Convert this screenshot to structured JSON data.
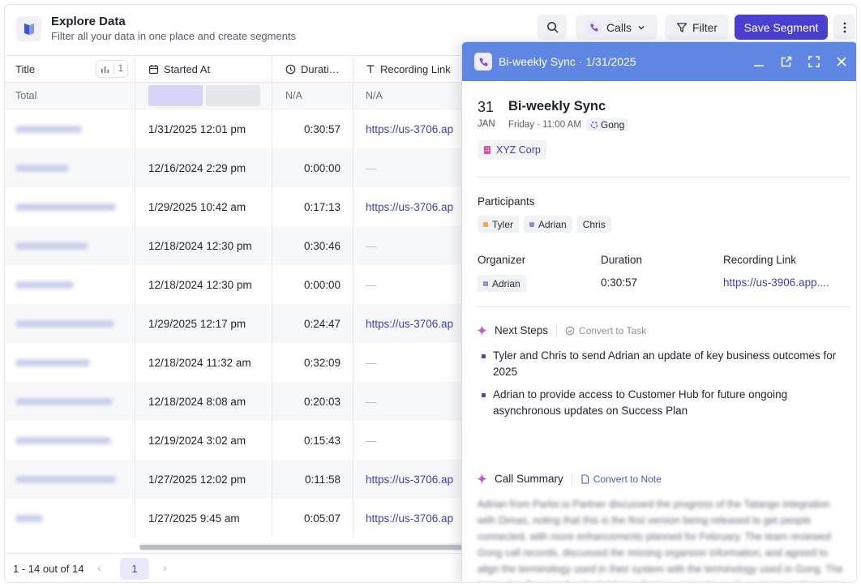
{
  "header": {
    "title": "Explore Data",
    "subtitle": "Filter all your data in one place and create segments",
    "logo_icon": "book-icon",
    "search_icon": "search-icon",
    "calls_label": "Calls",
    "calls_icon": "phone-icon",
    "filter_label": "Filter",
    "save_label": "Save Segment",
    "more_icon": "more-vertical-icon"
  },
  "table": {
    "columns": {
      "title": "Title",
      "title_sort_count": "1",
      "started_at": "Started At",
      "duration": "Durati…",
      "recording_link": "Recording Link"
    },
    "total": {
      "label": "Total",
      "duration": "N/A",
      "link": "N/A"
    },
    "rows": [
      {
        "started_at": "1/31/2025 12:01 pm",
        "duration": "0:30:57",
        "link": "https://us-3706.ap"
      },
      {
        "started_at": "12/16/2024 2:29 pm",
        "duration": "0:00:00",
        "link": "—"
      },
      {
        "started_at": "1/29/2025 10:42 am",
        "duration": "0:17:13",
        "link": "https://us-3706.ap"
      },
      {
        "started_at": "12/18/2024 12:30 pm",
        "duration": "0:30:46",
        "link": "—"
      },
      {
        "started_at": "12/18/2024 12:30 pm",
        "duration": "0:00:00",
        "link": "—"
      },
      {
        "started_at": "1/29/2025 12:17 pm",
        "duration": "0:24:47",
        "link": "https://us-3706.ap"
      },
      {
        "started_at": "12/18/2024 11:32 am",
        "duration": "0:32:09",
        "link": "—"
      },
      {
        "started_at": "12/18/2024 8:08 am",
        "duration": "0:20:03",
        "link": "—"
      },
      {
        "started_at": "12/19/2024 3:02 am",
        "duration": "0:15:43",
        "link": "—"
      },
      {
        "started_at": "1/27/2025 12:02 pm",
        "duration": "0:11:58",
        "link": "https://us-3706.ap"
      },
      {
        "started_at": "1/27/2025 9:45 am",
        "duration": "0:05:07",
        "link": "https://us-3706.ap"
      }
    ]
  },
  "footer": {
    "range": "1 - 14 out of 14",
    "current_page": "1"
  },
  "panel": {
    "title": "Bi-weekly Sync · 1/31/2025",
    "date_day": "31",
    "date_month": "JAN",
    "event_title": "Bi-weekly Sync",
    "event_when": "Friday · 11:00 AM",
    "source": "Gong",
    "company": "XYZ Corp",
    "participants_label": "Participants",
    "participants": [
      {
        "name": "Tyler",
        "color": "#f0a85a"
      },
      {
        "name": "Adrian",
        "color": "#8b8fd8"
      },
      {
        "name": "Chris",
        "color": ""
      }
    ],
    "organizer_label": "Organizer",
    "organizer": "Adrian",
    "duration_label": "Duration",
    "duration": "0:30:57",
    "recording_label": "Recording Link",
    "recording": "https://us-3906.app....",
    "next_steps_label": "Next Steps",
    "convert_task": "Convert to Task",
    "next_steps": [
      "Tyler and Chris to send Adrian an update of key business outcomes for 2025",
      "Adrian to provide access to Customer Hub for future ongoing asynchronous updates on Success Plan"
    ],
    "summary_label": "Call Summary",
    "convert_note": "Convert to Note",
    "summary_text": "Adrian from Parlor.io Partner discussed the progress of the Tatango integration with Dimas, noting that this is the first version being released to get people connected, with more enhancements planned for February. The team reviewed Gong call records, discussed the missing organizer information, and agreed to align the terminology used in their system with the terminology used in Gong. The team also discussed potential future feature requests, such as incorporating topics and tracks, automat"
  },
  "colors": {
    "accent": "#4a3fd0",
    "panel_header": "#5f86e2",
    "link": "#3c3fb0"
  }
}
